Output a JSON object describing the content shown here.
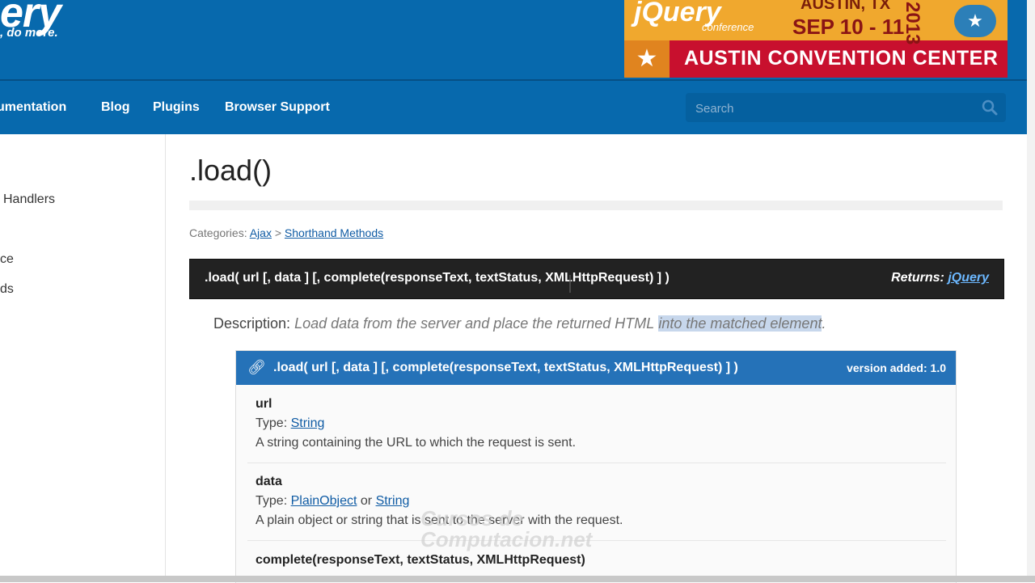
{
  "header": {
    "logo_text": "ery",
    "tagline": ", do more.",
    "banner": {
      "logo": "jQuery",
      "conference_label": "conference",
      "city": "AUSTIN, TX",
      "dates": "SEP 10 - 11",
      "year": "2013",
      "venue": "AUSTIN CONVENTION CENTER"
    }
  },
  "nav": {
    "items": [
      "umentation",
      "Blog",
      "Plugins",
      "Browser Support"
    ],
    "search_placeholder": "Search"
  },
  "sidebar": {
    "items": [
      "Handlers",
      "ce",
      "ds"
    ]
  },
  "main": {
    "title": ".load()",
    "categories_label": "Categories:",
    "categories": [
      "Ajax",
      "Shorthand Methods"
    ],
    "category_sep": ">",
    "signature": ".load( url [, data ] [, complete(responseText, textStatus, XMLHttpRequest) ] )",
    "returns_label": "Returns:",
    "returns_type": "jQuery",
    "description_label": "Description:",
    "description_text": "Load data from the server and place the returned HTML",
    "description_highlight": "into the matched element",
    "description_end": "."
  },
  "entry": {
    "signature": ".load( url [, data ] [, complete(responseText, textStatus, XMLHttpRequest) ] )",
    "version": "version added: 1.0",
    "params": [
      {
        "name": "url",
        "type_label": "Type:",
        "types": [
          "String"
        ],
        "desc": "A string containing the URL to which the request is sent."
      },
      {
        "name": "data",
        "type_label": "Type:",
        "types": [
          "PlainObject",
          "String"
        ],
        "type_join": "or",
        "desc": "A plain object or string that is sent to the server with the request."
      },
      {
        "name": "complete(responseText, textStatus, XMLHttpRequest)"
      }
    ]
  },
  "watermark": {
    "line1": "Cursos de",
    "line2": "Computacion.net"
  },
  "colors": {
    "header_blue": "#0769ad",
    "entry_blue": "#2572b8",
    "signature_dark": "#222222",
    "link": "#0f5ba4"
  }
}
